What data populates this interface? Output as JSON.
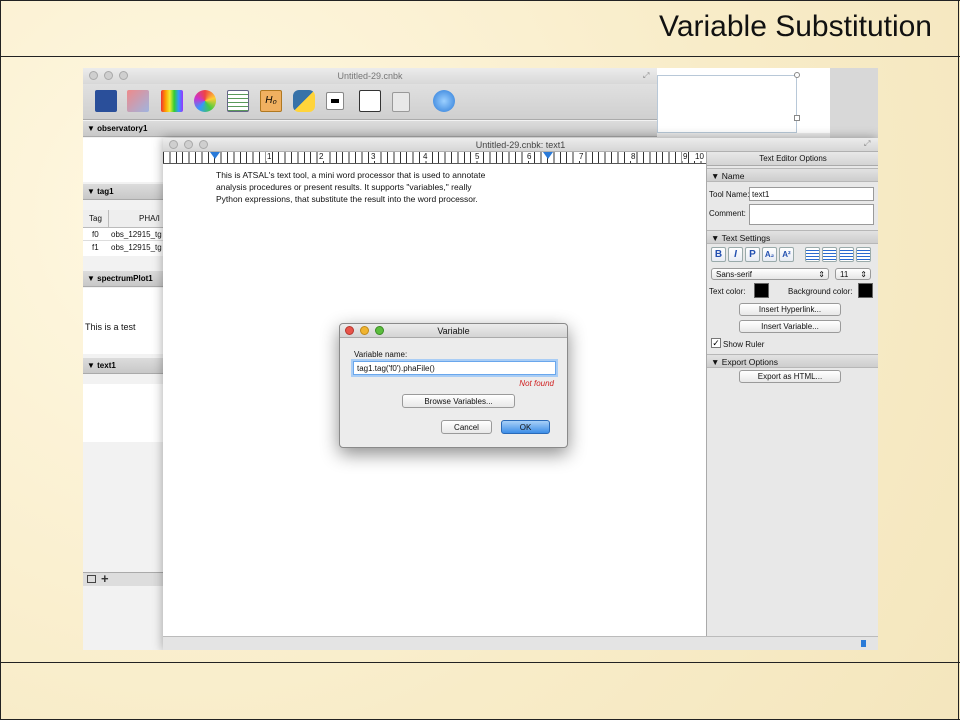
{
  "slide": {
    "title": "Variable Substitution"
  },
  "main_window": {
    "title": "Untitled-29.cnbk",
    "toolbar": {
      "icons": [
        "telescope-icon",
        "chart-tool-icon",
        "spectrum-icon",
        "color-wheel-icon",
        "table-icon",
        "h0-icon",
        "python-icon",
        "terminal-icon",
        "text-edit-icon",
        "notebook-icon",
        "refresh-icon"
      ],
      "h0_label": "H₀"
    },
    "panels": {
      "observatory": "▼ observatory1",
      "tag": "▼ tag1",
      "spectrum": "▼ spectrumPlot1",
      "text": "▼ text1"
    },
    "tag_table": {
      "headers": [
        "Tag",
        "PHA/I"
      ],
      "rows": [
        [
          "f0",
          "obs_12915_tg"
        ],
        [
          "f1",
          "obs_12915_tg"
        ]
      ]
    },
    "text_preview": "This is a test"
  },
  "editor_window": {
    "title": "Untitled-29.cnbk: text1",
    "ruler_numbers": [
      "1",
      "2",
      "3",
      "4",
      "5",
      "6",
      "7",
      "8",
      "9",
      "10"
    ],
    "body_lines": [
      "This is ATSAL's text tool, a mini word processor that is used to annotate",
      "analysis procedures or present results. It supports \"variables,\" really",
      "Python expressions, that substitute the result into the word processor."
    ]
  },
  "options_panel": {
    "header": "Text Editor Options",
    "name_section": "▼ Name",
    "tool_name_label": "Tool Name:",
    "tool_name_value": "text1",
    "comment_label": "Comment:",
    "text_settings_section": "▼ Text Settings",
    "format_buttons": [
      "B",
      "I",
      "P",
      "A₂",
      "A²"
    ],
    "font_family": "Sans-serif",
    "font_size": "11",
    "text_color_label": "Text color:",
    "background_color_label": "Background color:",
    "text_color": "#000000",
    "background_color": "#000000",
    "insert_hyperlink_label": "Insert Hyperlink...",
    "insert_variable_label": "Insert Variable...",
    "show_ruler_label": "Show Ruler",
    "show_ruler_checked": true,
    "export_section": "▼ Export Options",
    "export_html_label": "Export as HTML..."
  },
  "dialog": {
    "title": "Variable",
    "variable_name_label": "Variable name:",
    "variable_name_value": "tag1.tag('f0').phaFile()",
    "error_text": "Not found",
    "browse_label": "Browse Variables...",
    "cancel_label": "Cancel",
    "ok_label": "OK"
  },
  "colors": {
    "accent": "#3d8ee8",
    "error": "#d02020",
    "focus": "#6aa7ec"
  }
}
